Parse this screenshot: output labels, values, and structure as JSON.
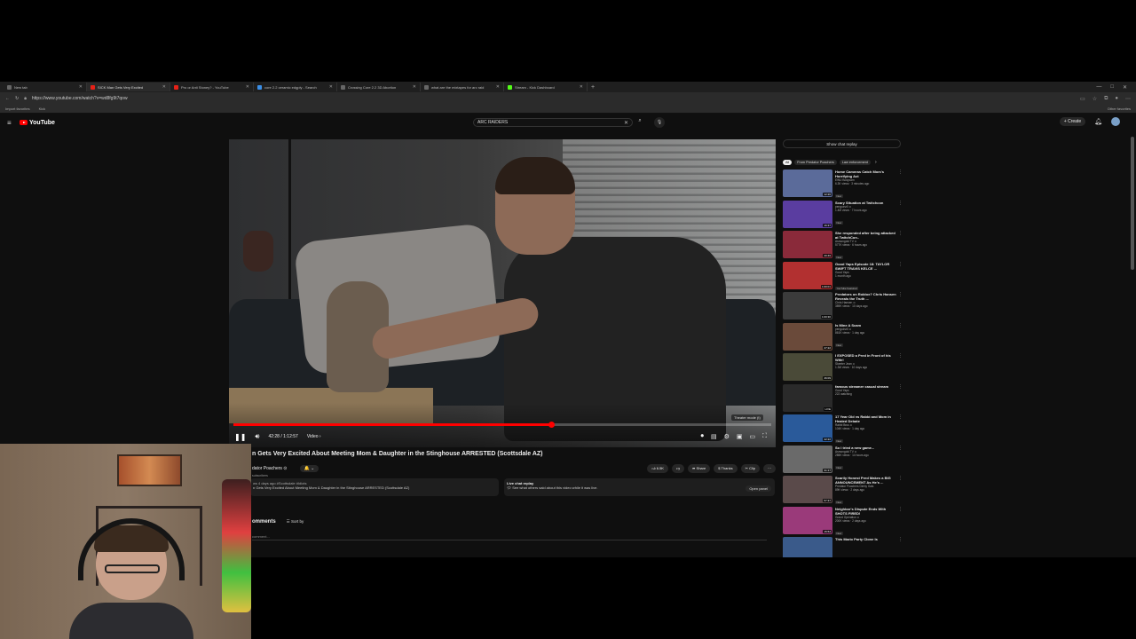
{
  "browser": {
    "tabs": [
      {
        "label": "New tab",
        "favicon": "newtab",
        "active": false
      },
      {
        "label": "SICK Man Gets Very Excited",
        "favicon": "yt",
        "active": true
      },
      {
        "label": "Pro or Anti Stoney? - YouTube",
        "favicon": "yt",
        "active": false
      },
      {
        "label": "core 2.2 ceramic edgply - Search",
        "favicon": "bing",
        "active": false
      },
      {
        "label": "Crossing Core 2.2 3D Abortion",
        "favicon": "page",
        "active": false
      },
      {
        "label": "what are the mixtapes for arc raid",
        "favicon": "page",
        "active": false
      },
      {
        "label": "Stream - Kick Dashboard",
        "favicon": "kick",
        "active": false
      }
    ],
    "new_tab_glyph": "+",
    "window_controls": [
      "—",
      "□",
      "✕"
    ],
    "url": "https://www.youtube.com/watch?v=wd8fg9t7qow",
    "bookmarks": [
      "Import favorites",
      "Kick"
    ],
    "other_favorites": "Other favorites"
  },
  "youtube": {
    "logo_text": "YouTube",
    "search": {
      "value": "ARC RAIDERS",
      "clear_glyph": "✕"
    },
    "create_label": "Create",
    "player": {
      "time": "42:28 / 1:12:57",
      "chapter": "Video",
      "theater_tip": "Theater mode (t)",
      "progress_fraction": 0.59
    },
    "video": {
      "title": "n Gets Very Excited About Meeting Mom & Daughter in the Stinghouse ARRESTED (Scottsdale AZ)",
      "channel": "dator Poachers ⊙",
      "subscribers": "subscribers",
      "bell_label": "🔔 ⌄",
      "likes": "6.5K",
      "share": "Share",
      "thanks": "Thanks",
      "clip": "Clip",
      "more": "⋯",
      "desc_meta": "ws  4 days ago  #Scottsdale #Idiots",
      "desc_text": "n Gets Very Excited About Meeting Mom & Daughter in the Stinghouse ARRESTED (Scottsdale AZ)",
      "chat_replay_title": "Live chat replay",
      "chat_replay_text": "See what others said about this video while it was live.",
      "open_panel": "Open panel"
    },
    "comments": {
      "heading": "omments",
      "sort_by": "Sort by",
      "add_placeholder": "comment..."
    },
    "sidebar": {
      "show_chat_replay": "Show chat replay",
      "chips": [
        "All",
        "From Predator Poachers",
        "Law enforcement"
      ],
      "recommendations": [
        {
          "title": "Home Cameras Catch Mom's Horrifying Act",
          "channel": "EWU Bodycam",
          "meta": "6.3K views · 3 minutes ago",
          "badge": "New",
          "duration": "12:26",
          "color": "#5b6b9a"
        },
        {
          "title": "Scary Situation at Twitchcon",
          "channel": "penguinz0 ⊙",
          "meta": "1.4M views · 7 hours ago",
          "badge": "New",
          "duration": "16:37",
          "color": "#5a3da0"
        },
        {
          "title": "She responded after being attacked at TwitchCon..",
          "channel": "Asmongold TV ⊙",
          "meta": "577K views · 6 hours ago",
          "badge": "New",
          "duration": "20:49",
          "color": "#8a2a3a"
        },
        {
          "title": "Good Yaps Episode 18: TAYLOR SWIFT TRAVIS KELCE ...",
          "channel": "Good Yaps",
          "meta": "1 month ago",
          "badge": "YouTube Featured",
          "duration": "1:00:01",
          "color": "#b23030"
        },
        {
          "title": "Predators on Roblox? Chris Hansen Reveals the Truth ...",
          "channel": "Chris Hansen ⊙",
          "meta": "389K views · 10 days ago",
          "badge": "",
          "duration": "1:00:30",
          "color": "#3b3b3b"
        },
        {
          "title": "Is Mine A Scam",
          "channel": "penguinz0 ⊙",
          "meta": "861K views · 1 day ago",
          "badge": "New",
          "duration": "27:22",
          "color": "#6a4a3a"
        },
        {
          "title": "I EXPOSED a Pred in Front of his Wife!",
          "channel": "Skeeter Jean ⊙",
          "meta": "1.3M views · 10 days ago",
          "badge": "",
          "duration": "46:09",
          "color": "#4a4a38"
        },
        {
          "title": "famous streamer casual stream",
          "channel": "Good Yaps",
          "meta": "222 watching",
          "badge": "",
          "duration": "LIVE",
          "color": "#2a2a2a"
        },
        {
          "title": "17 Year Old vs Rabbi and Mom in Heated Debate",
          "channel": "Rabbi Brus ⊙",
          "meta": "104K views · 1 day ago",
          "badge": "New",
          "duration": "22:22",
          "color": "#2a5a9a"
        },
        {
          "title": "So I tried a new game...",
          "channel": "Asmongold TV ⊙",
          "meta": "285K views · 14 hours ago",
          "badge": "New",
          "duration": "31:17",
          "color": "#6a6a6a"
        },
        {
          "title": "Scarily Honest Pred Makes a BIG ANNOUNCEMENT As He's ...",
          "channel": "Predator Poachers Derby Gals",
          "meta": "89K views · 2 days ago",
          "badge": "New",
          "duration": "57:37",
          "color": "#5a4a4a"
        },
        {
          "title": "Neighbor's Dispute Ends With SHOTS FIRED!",
          "channel": "Grand Operation ⊙",
          "meta": "200K views · 2 days ago",
          "badge": "New",
          "duration": "15:54",
          "color": "#9a3a7a"
        },
        {
          "title": "This Mario Party Clone Is",
          "channel": "",
          "meta": "",
          "badge": "",
          "duration": "",
          "color": "#3a5a8a"
        }
      ]
    }
  }
}
